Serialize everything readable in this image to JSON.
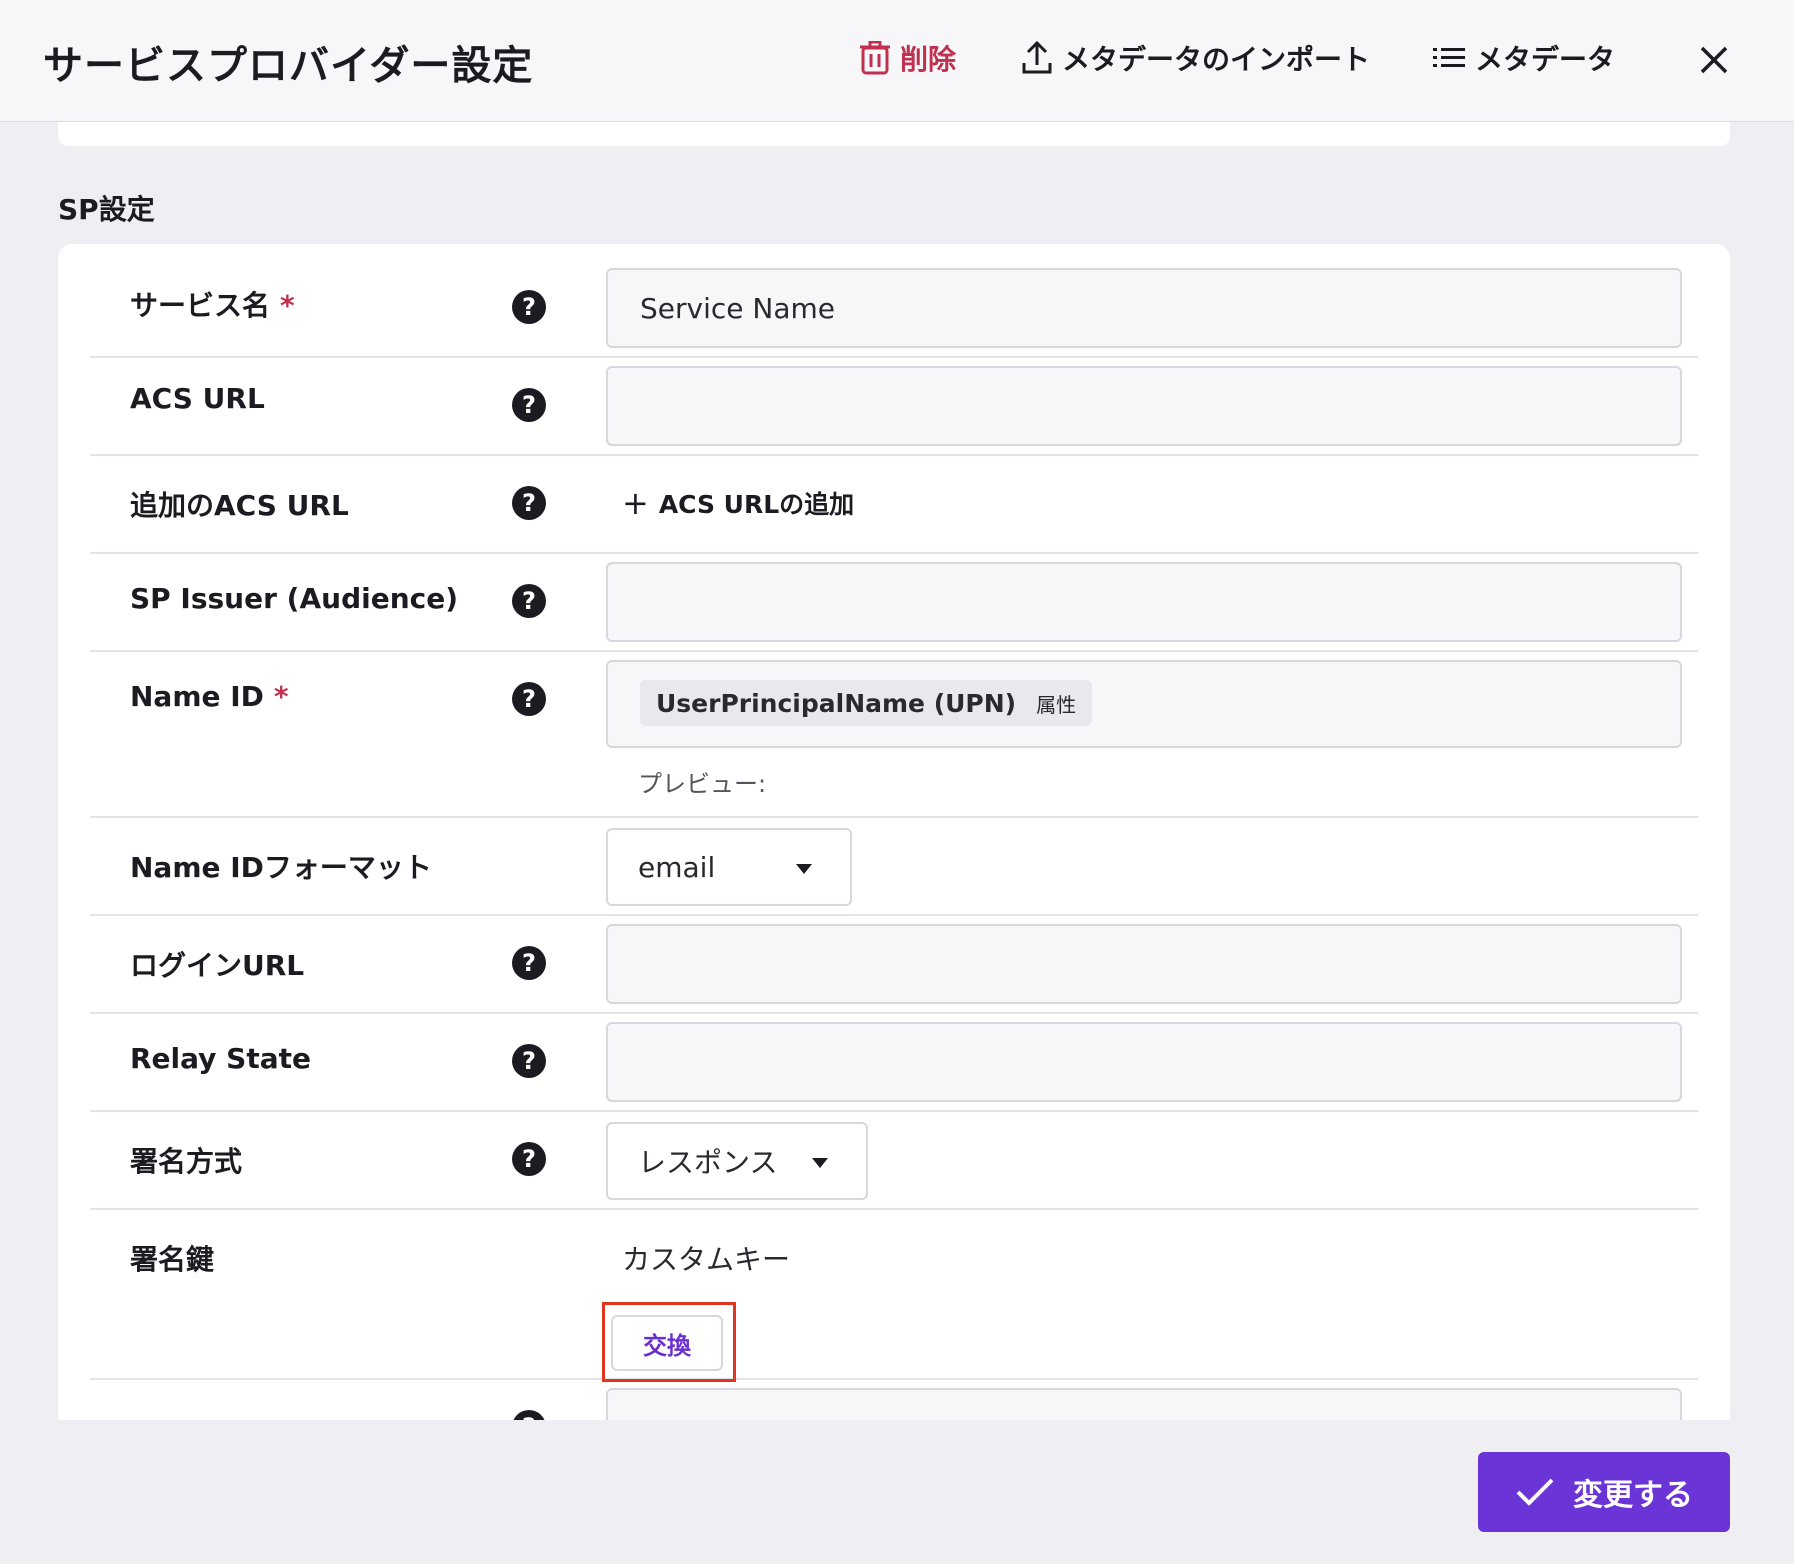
{
  "header": {
    "title": "サービスプロバイダー設定",
    "delete_label": "削除",
    "import_label": "メタデータのインポート",
    "metadata_label": "メタデータ"
  },
  "section": {
    "title": "SP設定"
  },
  "fields": {
    "service_name": {
      "label": "サービス名",
      "required": "*",
      "value": "Service Name"
    },
    "acs_url": {
      "label": "ACS URL",
      "value": ""
    },
    "additional_acs": {
      "label": "追加のACS URL",
      "add_label": "ACS URLの追加"
    },
    "sp_issuer": {
      "label": "SP Issuer (Audience)",
      "value": ""
    },
    "name_id": {
      "label": "Name ID",
      "required": "*",
      "chip_value": "UserPrincipalName (UPN)",
      "chip_tag": "属性",
      "preview_label": "プレビュー:"
    },
    "name_id_format": {
      "label": "Name IDフォーマット",
      "selected": "email"
    },
    "login_url": {
      "label": "ログインURL",
      "value": ""
    },
    "relay_state": {
      "label": "Relay State",
      "value": ""
    },
    "signing_method": {
      "label": "署名方式",
      "selected": "レスポンス"
    },
    "signing_key": {
      "label": "署名鍵",
      "value": "カスタムキー",
      "swap_label": "交換"
    }
  },
  "footer": {
    "submit_label": "変更する"
  },
  "colors": {
    "accent": "#6a34d6",
    "danger": "#c0304f",
    "highlight": "#e0361f"
  }
}
